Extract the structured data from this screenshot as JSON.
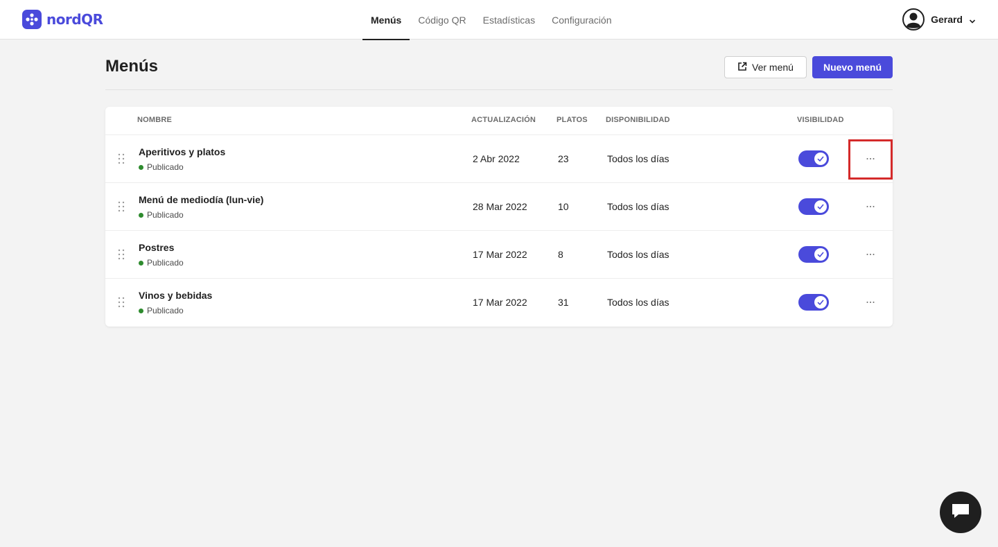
{
  "app": {
    "name": "nordQR",
    "brand_color": "#4a4adb"
  },
  "nav": {
    "tabs": [
      {
        "label": "Menús",
        "active": true
      },
      {
        "label": "Código QR",
        "active": false
      },
      {
        "label": "Estadísticas",
        "active": false
      },
      {
        "label": "Configuración",
        "active": false
      }
    ]
  },
  "user": {
    "name": "Gerard",
    "avatar_icon": "user-avatar-icon"
  },
  "page": {
    "title": "Menús",
    "ver_menu_label": "Ver menú",
    "nuevo_menu_label": "Nuevo menú"
  },
  "table": {
    "columns": {
      "nombre": "NOMBRE",
      "actualizacion": "ACTUALIZACIÓN",
      "platos": "PLATOS",
      "disponibilidad": "DISPONIBILIDAD",
      "visibilidad": "VISIBILIDAD"
    },
    "rows": [
      {
        "name": "Aperitivos y platos",
        "status": "Publicado",
        "date": "2 Abr 2022",
        "dishes": "23",
        "availability": "Todos los días",
        "visible": true
      },
      {
        "name": "Menú de mediodía (lun-vie)",
        "status": "Publicado",
        "date": "28 Mar 2022",
        "dishes": "10",
        "availability": "Todos los días",
        "visible": true
      },
      {
        "name": "Postres",
        "status": "Publicado",
        "date": "17 Mar 2022",
        "dishes": "8",
        "availability": "Todos los días",
        "visible": true
      },
      {
        "name": "Vinos y bebidas",
        "status": "Publicado",
        "date": "17 Mar 2022",
        "dishes": "31",
        "availability": "Todos los días",
        "visible": true
      }
    ],
    "status_color": "#2e8b2e",
    "more_label": "···",
    "highlight_color": "#d42a2a"
  }
}
